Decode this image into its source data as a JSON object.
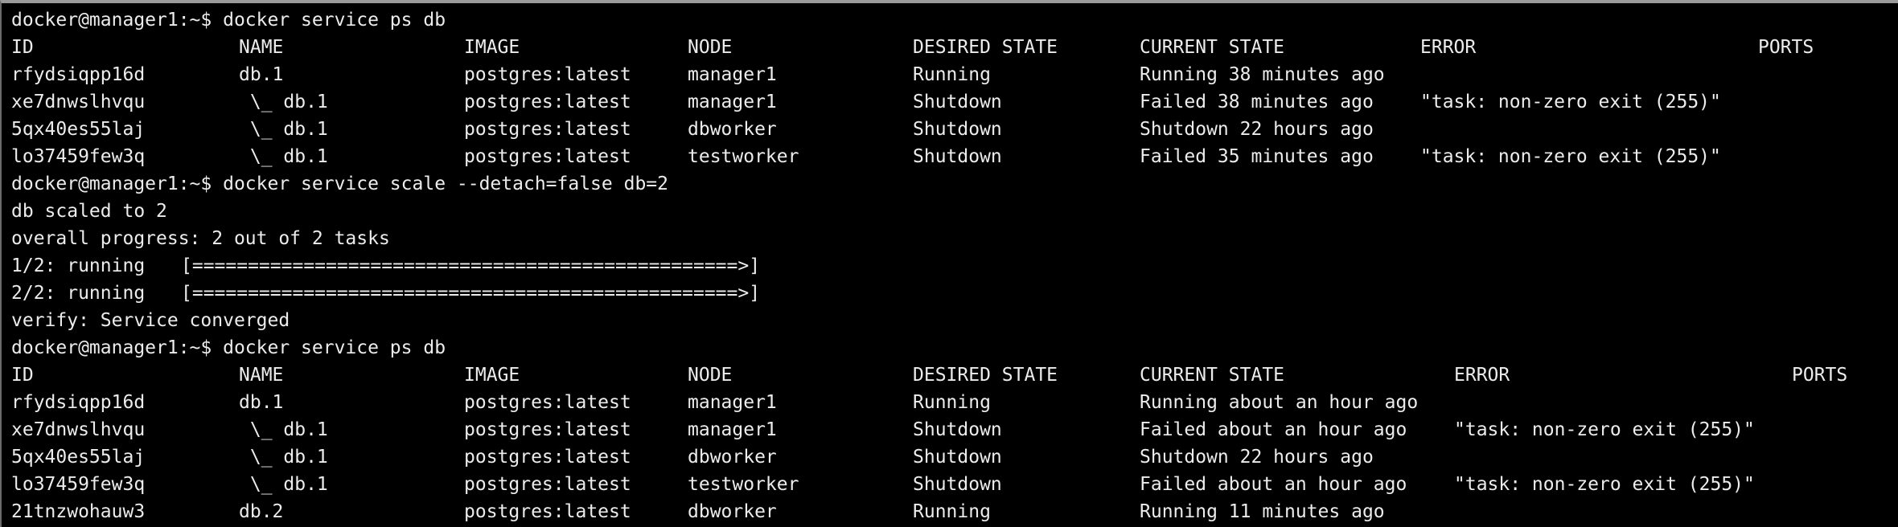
{
  "terminal": {
    "colors": {
      "background": "#000000",
      "text": "#ececec"
    },
    "lines": [
      {
        "type": "text",
        "text": "docker@manager1:~$ docker service ps db"
      },
      {
        "type": "table",
        "table": 0,
        "cells": [
          "ID",
          "NAME",
          "IMAGE",
          "NODE",
          "DESIRED STATE",
          "CURRENT STATE",
          "ERROR",
          "PORTS"
        ]
      },
      {
        "type": "table",
        "table": 0,
        "cells": [
          "rfydsiqpp16d",
          "db.1",
          "postgres:latest",
          "manager1",
          "Running",
          "Running 38 minutes ago",
          "",
          ""
        ]
      },
      {
        "type": "table",
        "table": 0,
        "cells": [
          "xe7dnwslhvqu",
          " \\_ db.1",
          "postgres:latest",
          "manager1",
          "Shutdown",
          "Failed 38 minutes ago",
          "\"task: non-zero exit (255)\"",
          ""
        ]
      },
      {
        "type": "table",
        "table": 0,
        "cells": [
          "5qx40es55laj",
          " \\_ db.1",
          "postgres:latest",
          "dbworker",
          "Shutdown",
          "Shutdown 22 hours ago",
          "",
          ""
        ]
      },
      {
        "type": "table",
        "table": 0,
        "cells": [
          "lo37459few3q",
          " \\_ db.1",
          "postgres:latest",
          "testworker",
          "Shutdown",
          "Failed 35 minutes ago",
          "\"task: non-zero exit (255)\"",
          ""
        ]
      },
      {
        "type": "text",
        "text": "docker@manager1:~$ docker service scale --detach=false db=2"
      },
      {
        "type": "text",
        "text": "db scaled to 2"
      },
      {
        "type": "text",
        "text": "overall progress: 2 out of 2 tasks"
      },
      {
        "type": "progress",
        "label": "1/2: running",
        "bar": "[=================================================>]",
        "progress": 1.0
      },
      {
        "type": "progress",
        "label": "2/2: running",
        "bar": "[=================================================>]",
        "progress": 1.0
      },
      {
        "type": "text",
        "text": "verify: Service converged"
      },
      {
        "type": "text",
        "text": "docker@manager1:~$ docker service ps db"
      },
      {
        "type": "table",
        "table": 1,
        "cells": [
          "ID",
          "NAME",
          "IMAGE",
          "NODE",
          "DESIRED STATE",
          "CURRENT STATE",
          "ERROR",
          "PORTS"
        ]
      },
      {
        "type": "table",
        "table": 1,
        "cells": [
          "rfydsiqpp16d",
          "db.1",
          "postgres:latest",
          "manager1",
          "Running",
          "Running about an hour ago",
          "",
          ""
        ]
      },
      {
        "type": "table",
        "table": 1,
        "cells": [
          "xe7dnwslhvqu",
          " \\_ db.1",
          "postgres:latest",
          "manager1",
          "Shutdown",
          "Failed about an hour ago",
          "\"task: non-zero exit (255)\"",
          ""
        ]
      },
      {
        "type": "table",
        "table": 1,
        "cells": [
          "5qx40es55laj",
          " \\_ db.1",
          "postgres:latest",
          "dbworker",
          "Shutdown",
          "Shutdown 22 hours ago",
          "",
          ""
        ]
      },
      {
        "type": "table",
        "table": 1,
        "cells": [
          "lo37459few3q",
          " \\_ db.1",
          "postgres:latest",
          "testworker",
          "Shutdown",
          "Failed about an hour ago",
          "\"task: non-zero exit (255)\"",
          ""
        ]
      },
      {
        "type": "table",
        "table": 1,
        "cells": [
          "21tnzwohauw3",
          "db.2",
          "postgres:latest",
          "dbworker",
          "Running",
          "Running 11 minutes ago",
          "",
          ""
        ]
      }
    ]
  }
}
